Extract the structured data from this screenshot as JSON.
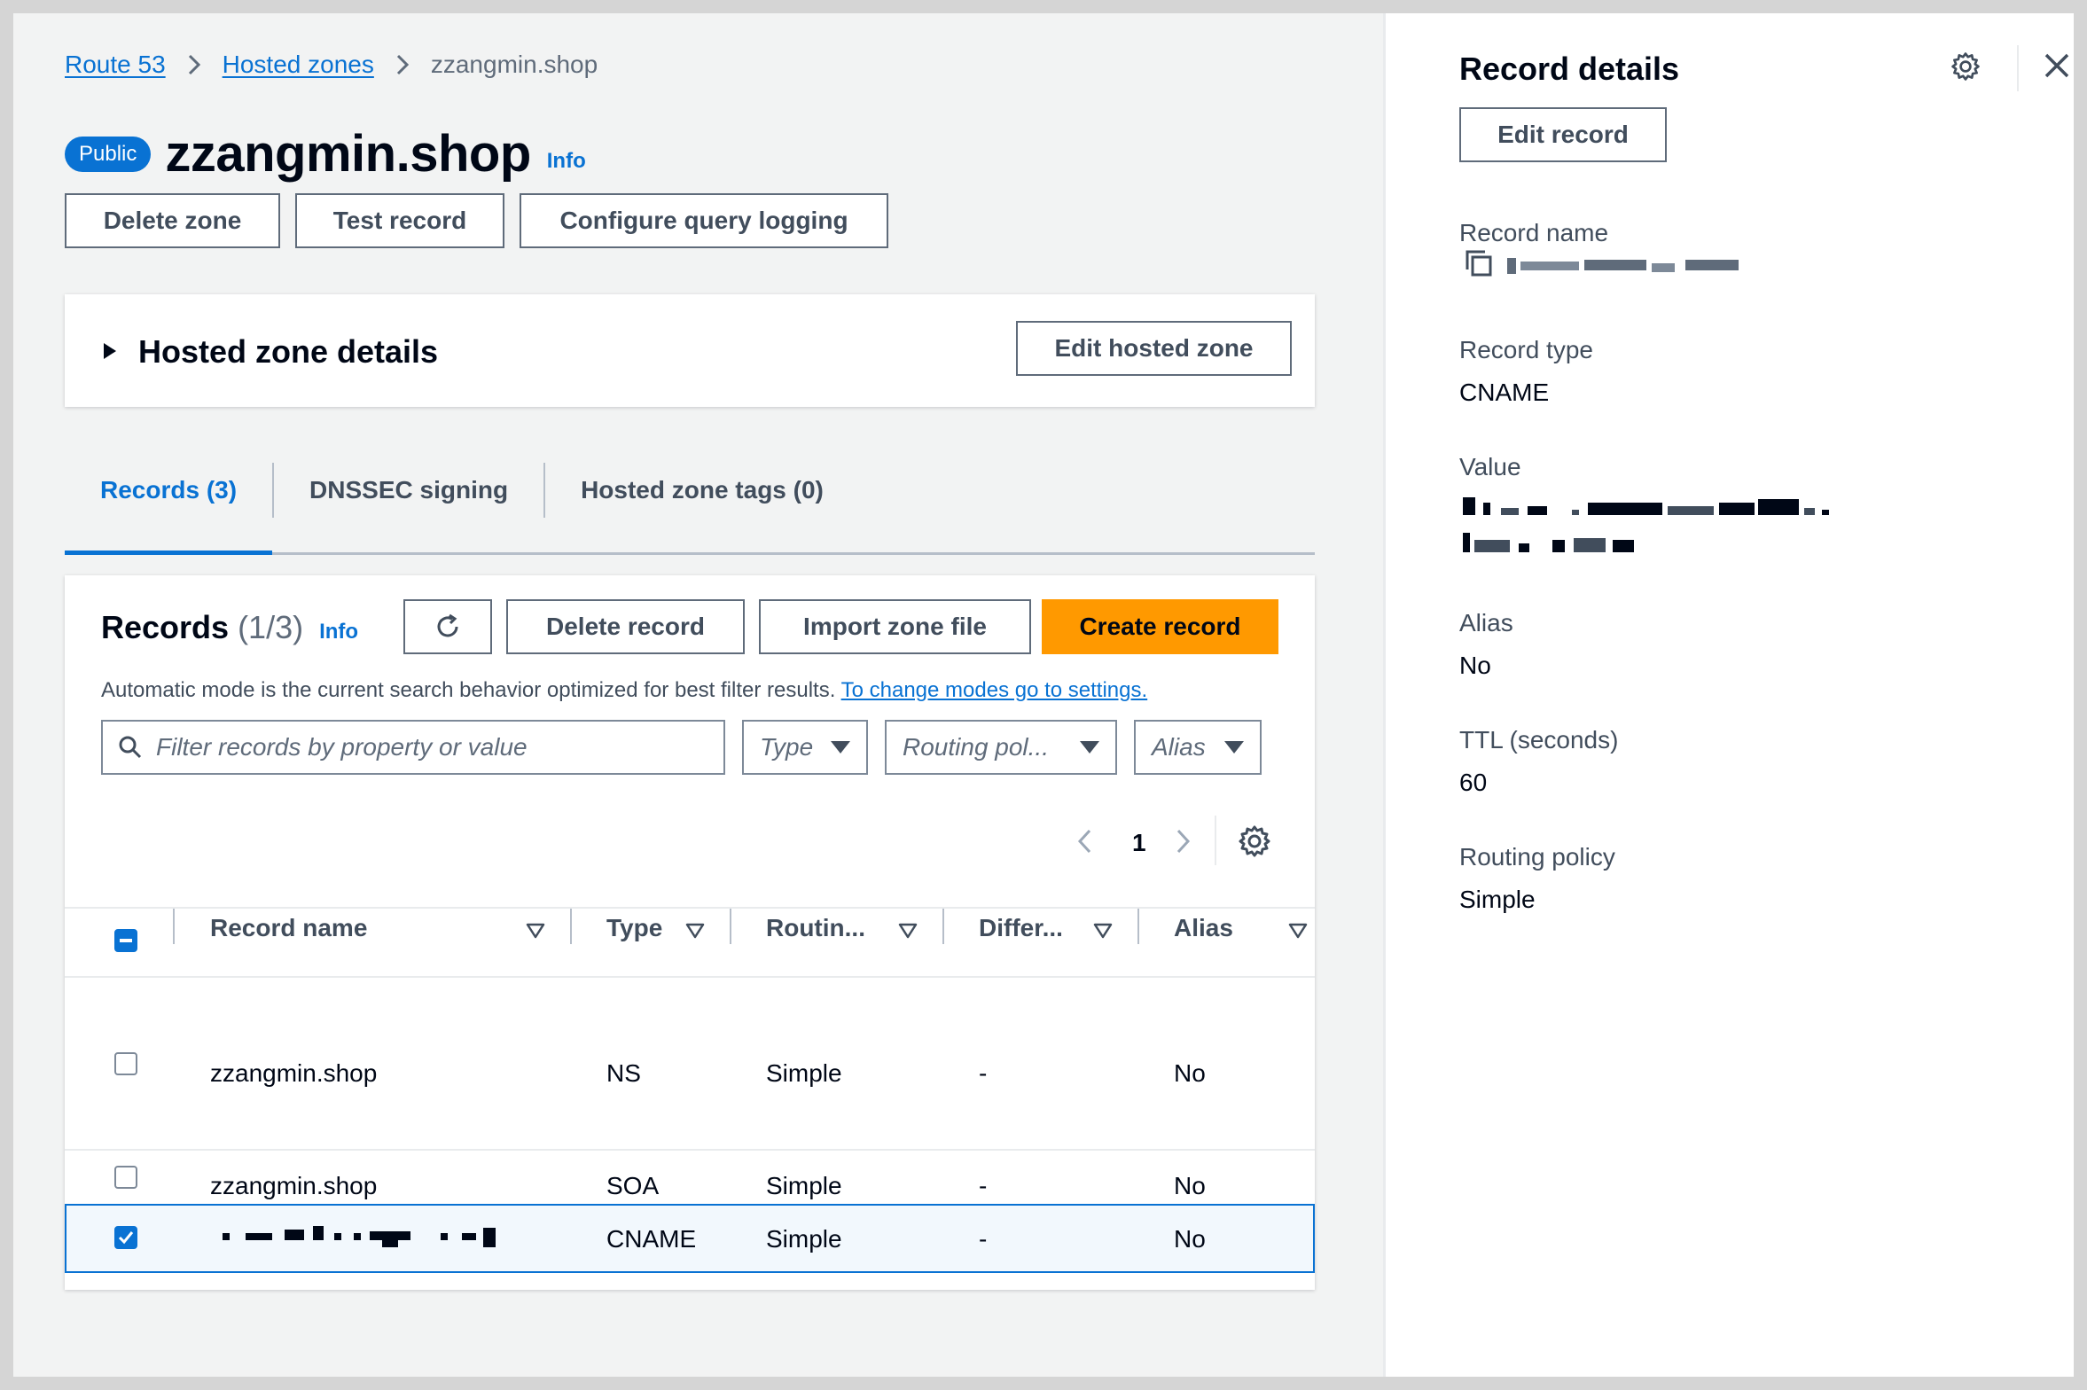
{
  "breadcrumb": {
    "items": [
      "Route 53",
      "Hosted zones"
    ],
    "current": "zzangmin.shop"
  },
  "header": {
    "badge": "Public",
    "title": "zzangmin.shop",
    "info": "Info"
  },
  "actions": {
    "delete_zone": "Delete zone",
    "test_record": "Test record",
    "configure_logging": "Configure query logging"
  },
  "zone_details": {
    "title": "Hosted zone details",
    "edit": "Edit hosted zone"
  },
  "tabs": [
    {
      "label": "Records (3)"
    },
    {
      "label": "DNSSEC signing"
    },
    {
      "label": "Hosted zone tags (0)"
    }
  ],
  "records_panel": {
    "title": "Records",
    "count": "(1/3)",
    "info": "Info",
    "delete": "Delete record",
    "import": "Import zone file",
    "create": "Create record",
    "mode_text": "Automatic mode is the current search behavior optimized for best filter results.",
    "mode_link": "To change modes go to settings.",
    "filter_placeholder": "Filter records by property or value",
    "type_filter": "Type",
    "routing_filter": "Routing pol...",
    "alias_filter": "Alias",
    "page": "1"
  },
  "table": {
    "columns": [
      "Record name",
      "Type",
      "Routin...",
      "Differ...",
      "Alias"
    ],
    "rows": [
      {
        "name": "zzangmin.shop",
        "type": "NS",
        "routing": "Simple",
        "differ": "-",
        "alias": "No",
        "checked": false
      },
      {
        "name": "zzangmin.shop",
        "type": "SOA",
        "routing": "Simple",
        "differ": "-",
        "alias": "No",
        "checked": false
      },
      {
        "name": "",
        "type": "CNAME",
        "routing": "Simple",
        "differ": "-",
        "alias": "No",
        "checked": true
      }
    ]
  },
  "record_details": {
    "title": "Record details",
    "edit": "Edit record",
    "record_name_label": "Record name",
    "record_type_label": "Record type",
    "record_type": "CNAME",
    "value_label": "Value",
    "alias_label": "Alias",
    "alias": "No",
    "ttl_label": "TTL (seconds)",
    "ttl": "60",
    "routing_label": "Routing policy",
    "routing": "Simple"
  },
  "colors": {
    "link": "#0972d3",
    "primary_button": "#ff9900",
    "text": "#000716",
    "background": "#f2f3f3"
  }
}
